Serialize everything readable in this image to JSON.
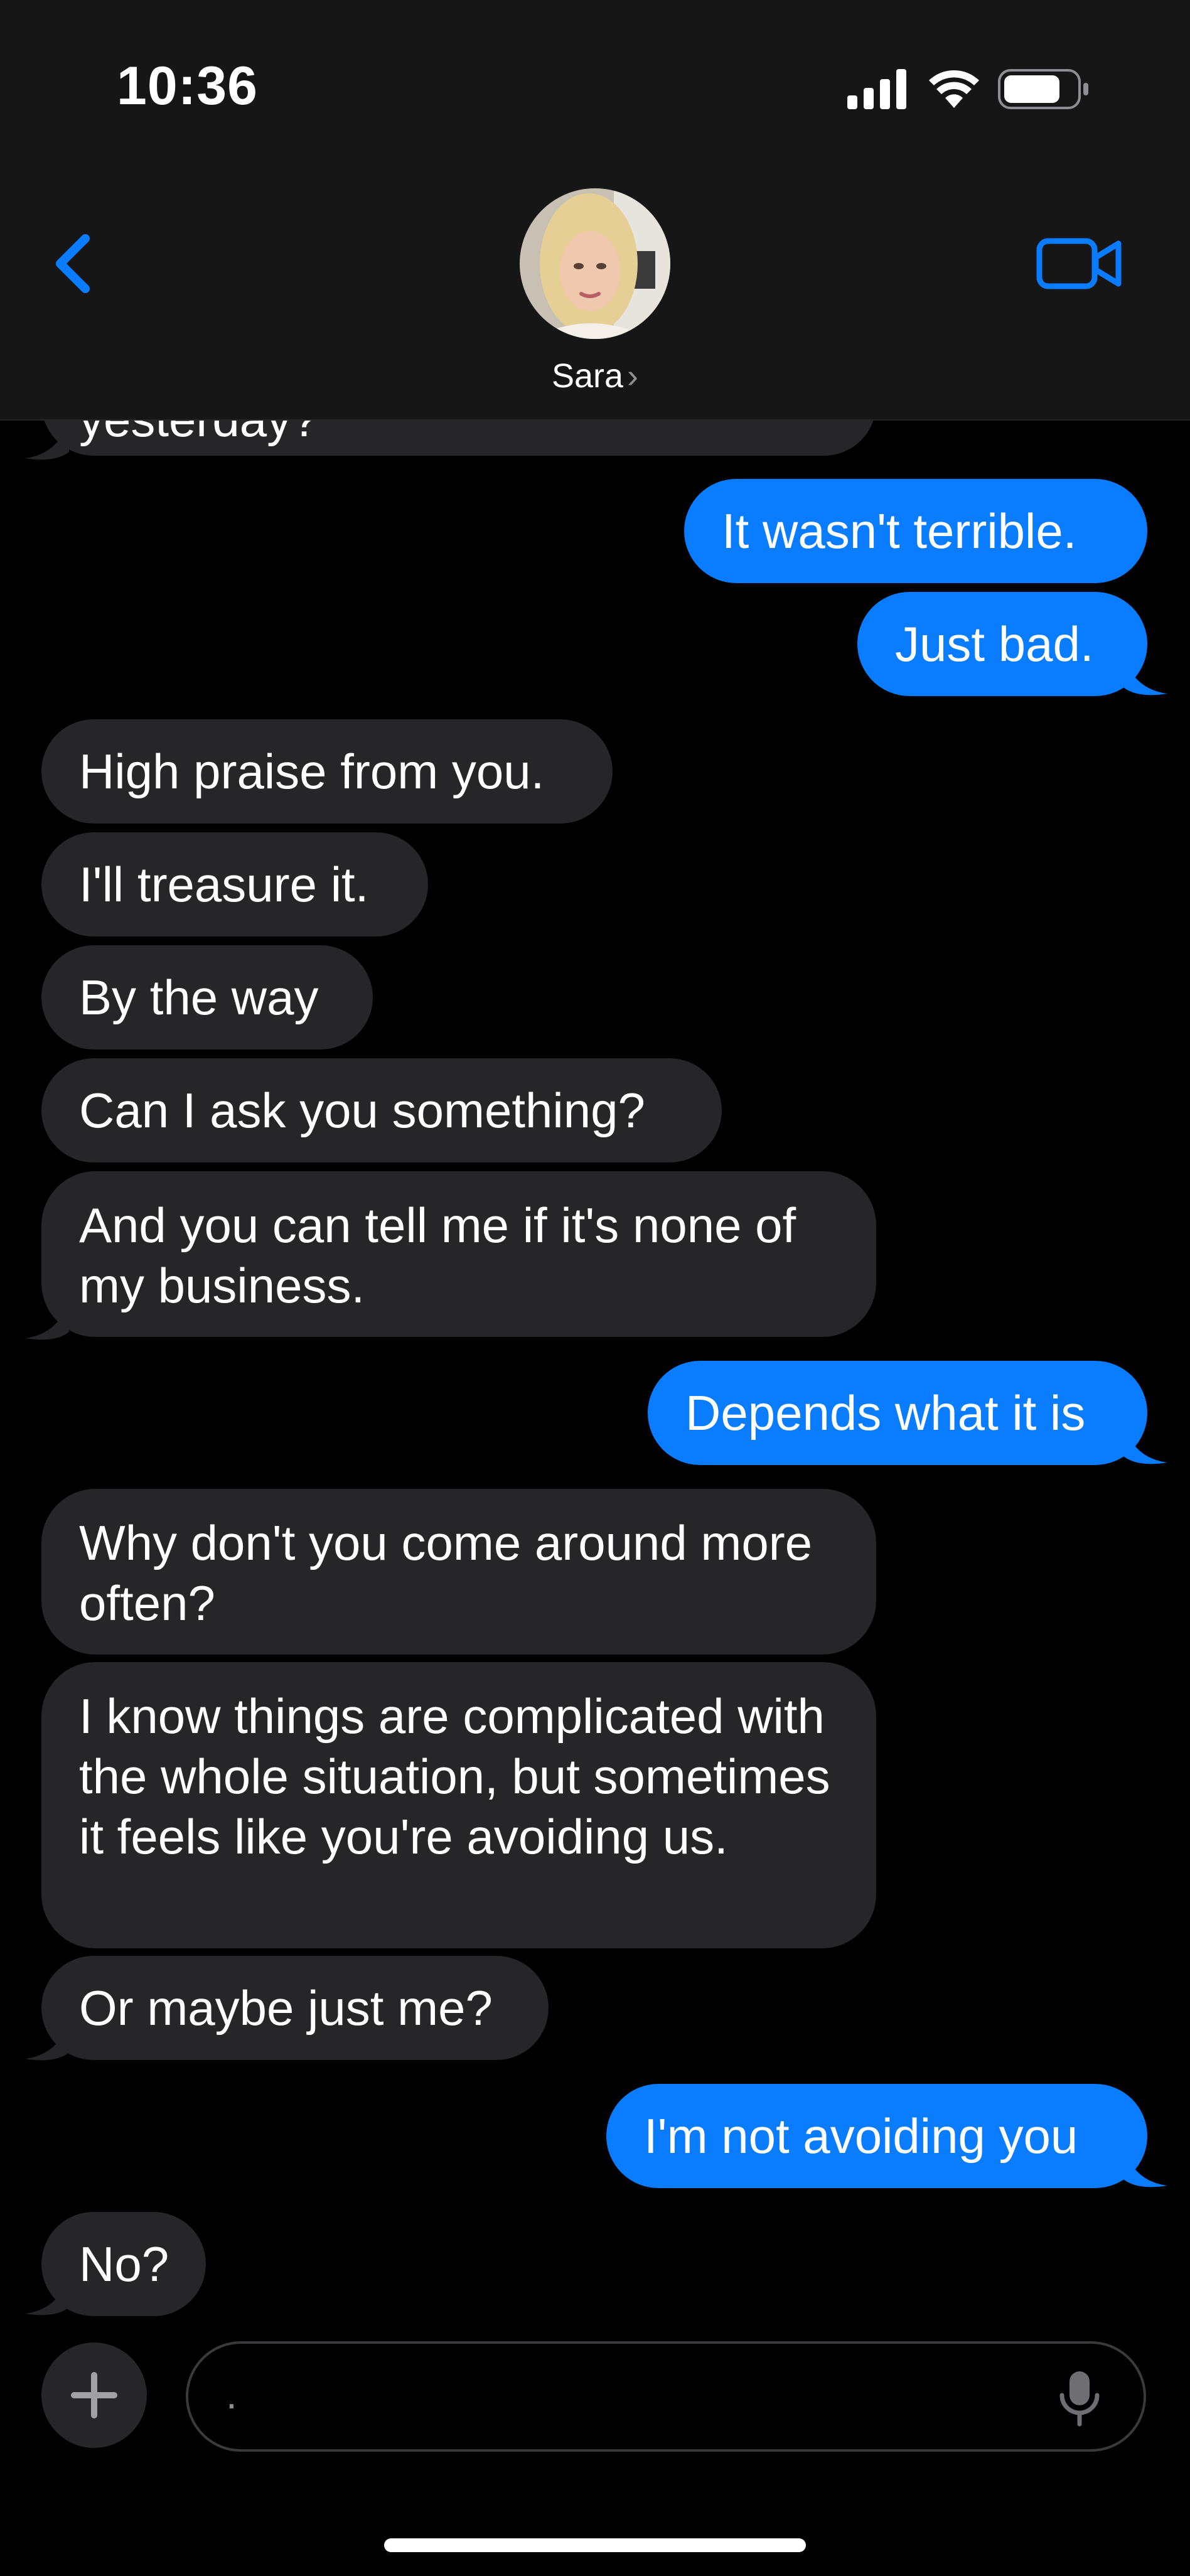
{
  "status_bar": {
    "time": "10:36"
  },
  "header": {
    "contact_name": "Sara",
    "chevron": "›",
    "back_icon": "chevron-left-icon",
    "video_icon": "video-camera-icon"
  },
  "colors": {
    "accent": "#0a7cff",
    "incoming_bubble": "#262628",
    "header_bg": "#161616"
  },
  "messages": [
    {
      "dir": "in",
      "text": "yesterday?"
    },
    {
      "dir": "out",
      "text": "It wasn't terrible."
    },
    {
      "dir": "out",
      "text": "Just bad."
    },
    {
      "dir": "in",
      "text": "High praise from you."
    },
    {
      "dir": "in",
      "text": "I'll treasure it."
    },
    {
      "dir": "in",
      "text": "By the way"
    },
    {
      "dir": "in",
      "text": "Can I ask you something?"
    },
    {
      "dir": "in",
      "text": "And you can tell me if it's none of my business."
    },
    {
      "dir": "out",
      "text": "Depends what it is"
    },
    {
      "dir": "in",
      "text": "Why don't you come around more often?"
    },
    {
      "dir": "in",
      "text": "I know things are complicated with the whole situation, but sometimes it feels like you're avoiding us."
    },
    {
      "dir": "in",
      "text": "Or maybe just me?"
    },
    {
      "dir": "out",
      "text": "I'm not avoiding you"
    },
    {
      "dir": "in",
      "text": "No?"
    }
  ],
  "composer": {
    "placeholder": ".",
    "plus_icon": "plus-icon",
    "mic_icon": "microphone-icon"
  }
}
